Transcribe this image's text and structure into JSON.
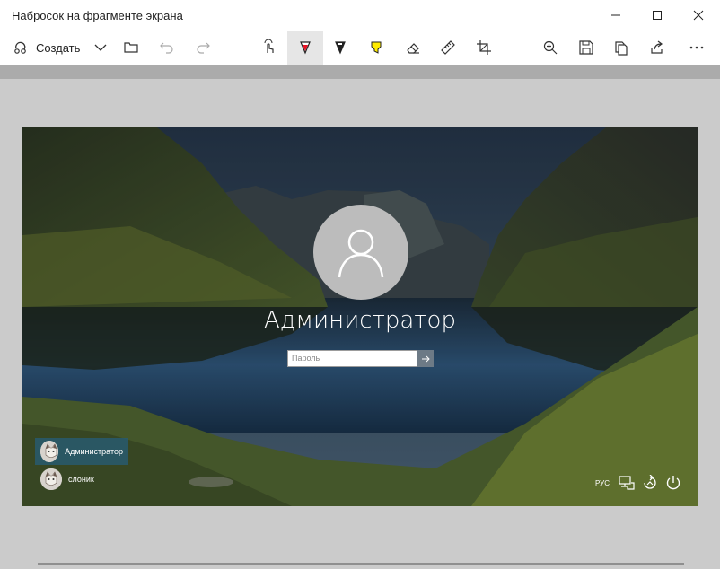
{
  "window": {
    "title": "Набросок на фрагменте экрана"
  },
  "toolbar": {
    "create_label": "Создать",
    "tools": [
      "touch-writing-icon",
      "ballpoint-pen-icon",
      "pencil-icon",
      "highlighter-icon",
      "eraser-icon",
      "ruler-icon",
      "crop-icon"
    ],
    "active_tool": "ballpoint-pen-icon",
    "pen_color": "#e81123",
    "highlighter_color": "#ffeb00"
  },
  "screenshot": {
    "user_name": "Администратор",
    "password_placeholder": "Пароль",
    "users": [
      {
        "name": "Администратор",
        "selected": true
      },
      {
        "name": "слоник",
        "selected": false
      }
    ],
    "language": "РУС"
  }
}
